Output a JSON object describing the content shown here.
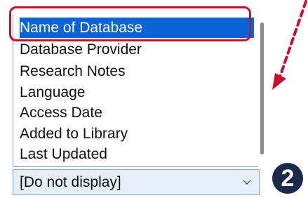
{
  "dropdown": {
    "items": [
      "Name of Database",
      "Database Provider",
      "Research Notes",
      "Language",
      "Access Date",
      "Added to Library",
      "Last Updated"
    ],
    "selected_index": 0,
    "selection_color": "#0a64d6"
  },
  "combobox": {
    "value": "[Do not display]",
    "arrow_icon": "chevron-down-icon"
  },
  "annotations": {
    "step_number": "2",
    "highlight_color": "#c8102e",
    "arrow_color": "#c8102e"
  }
}
